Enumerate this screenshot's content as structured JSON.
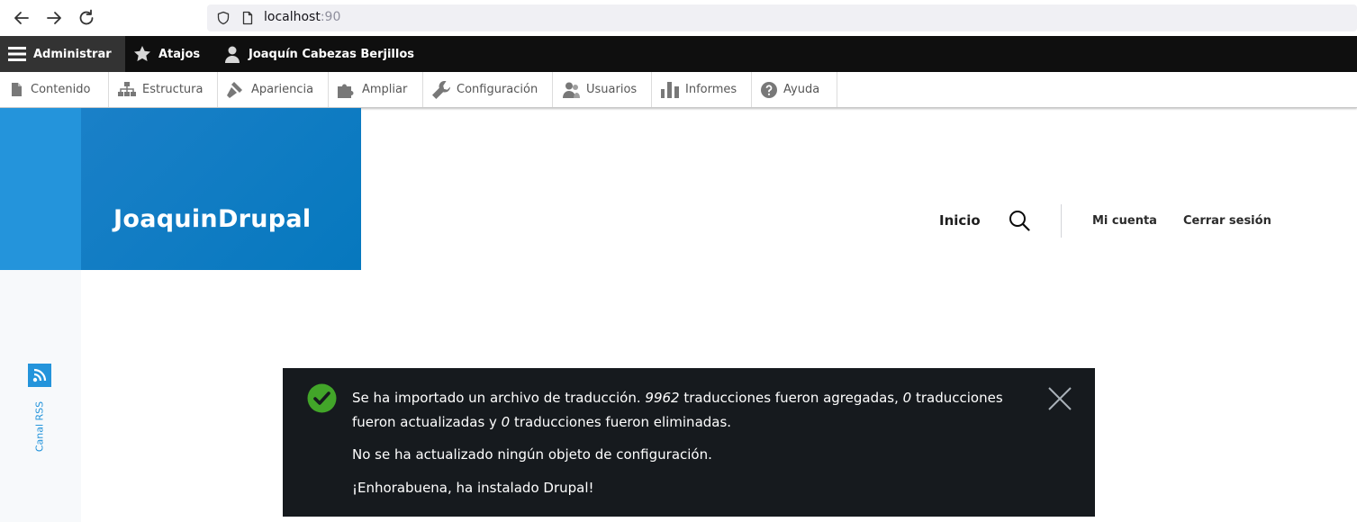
{
  "browser": {
    "url_host": "localhost",
    "url_port": ":90",
    "icons": [
      "back-arrow-icon",
      "forward-arrow-icon",
      "reload-icon",
      "shield-icon",
      "page-icon"
    ]
  },
  "toolbar": {
    "admin_label": "Administrar",
    "shortcuts_label": "Atajos",
    "user_label": "Joaquín Cabezas Berjillos"
  },
  "tray": {
    "items": [
      {
        "label": "Contenido",
        "icon": "file-icon"
      },
      {
        "label": "Estructura",
        "icon": "sitemap-icon"
      },
      {
        "label": "Apariencia",
        "icon": "brush-icon"
      },
      {
        "label": "Ampliar",
        "icon": "puzzle-icon"
      },
      {
        "label": "Configuración",
        "icon": "wrench-icon"
      },
      {
        "label": "Usuarios",
        "icon": "people-icon"
      },
      {
        "label": "Informes",
        "icon": "bar-chart-icon"
      },
      {
        "label": "Ayuda",
        "icon": "help-icon"
      }
    ]
  },
  "header": {
    "site_name": "JoaquinDrupal",
    "nav_home": "Inicio",
    "nav_account": "Mi cuenta",
    "nav_logout": "Cerrar sesión"
  },
  "sidebar": {
    "rss_label": "Canal RSS"
  },
  "message": {
    "line1_a": "Se ha importado un archivo de traducción. ",
    "line1_count_added": "9962",
    "line1_b": " traducciones fueron agregadas, ",
    "line1_count_updated": "0",
    "line1_c": " traducciones",
    "line2_a": "fueron actualizadas y ",
    "line2_count_deleted": "0",
    "line2_b": " traducciones fueron eliminadas.",
    "line3": "No se ha actualizado ningún objeto de configuración.",
    "line4": "¡Enhorabuena, ha instalado Drupal!"
  },
  "colors": {
    "toolbar_bg": "#0f0f0f",
    "brand_blue": "#0678be",
    "message_bg": "#161a1e",
    "success_green": "#42a529"
  }
}
